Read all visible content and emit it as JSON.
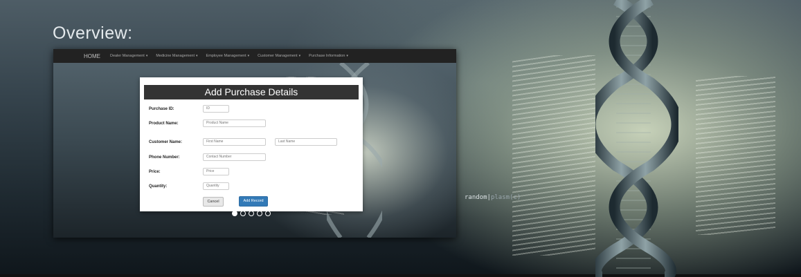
{
  "page": {
    "title": "Overview:"
  },
  "logo": {
    "main": "random",
    "sep": "|",
    "dim": "plasm(c)"
  },
  "app": {
    "nav": {
      "home": "HOME",
      "items": [
        {
          "label": "Dealer Management"
        },
        {
          "label": "Medicine Management"
        },
        {
          "label": "Employee Management"
        },
        {
          "label": "Customer Management"
        },
        {
          "label": "Purchase Information"
        }
      ],
      "caret": "▾"
    },
    "form": {
      "title": "Add Purchase Details",
      "labels": {
        "purchase_id": "Purchase ID:",
        "product_name": "Product Name:",
        "customer_name": "Customer Name:",
        "phone": "Phone Number:",
        "price": "Price:",
        "quantity": "Quantity:"
      },
      "placeholders": {
        "id": "ID",
        "product_name": "Product Name",
        "first_name": "First Name",
        "last_name": "Last Name",
        "contact": "Contact Number",
        "price": "Price",
        "quantity": "Quantity"
      },
      "buttons": {
        "cancel": "Cancel",
        "add": "Add Record"
      }
    },
    "carousel": {
      "count": 5,
      "active": 1
    }
  },
  "colors": {
    "navbar": "#222222",
    "header": "#333333",
    "primary": "#337ab7"
  }
}
